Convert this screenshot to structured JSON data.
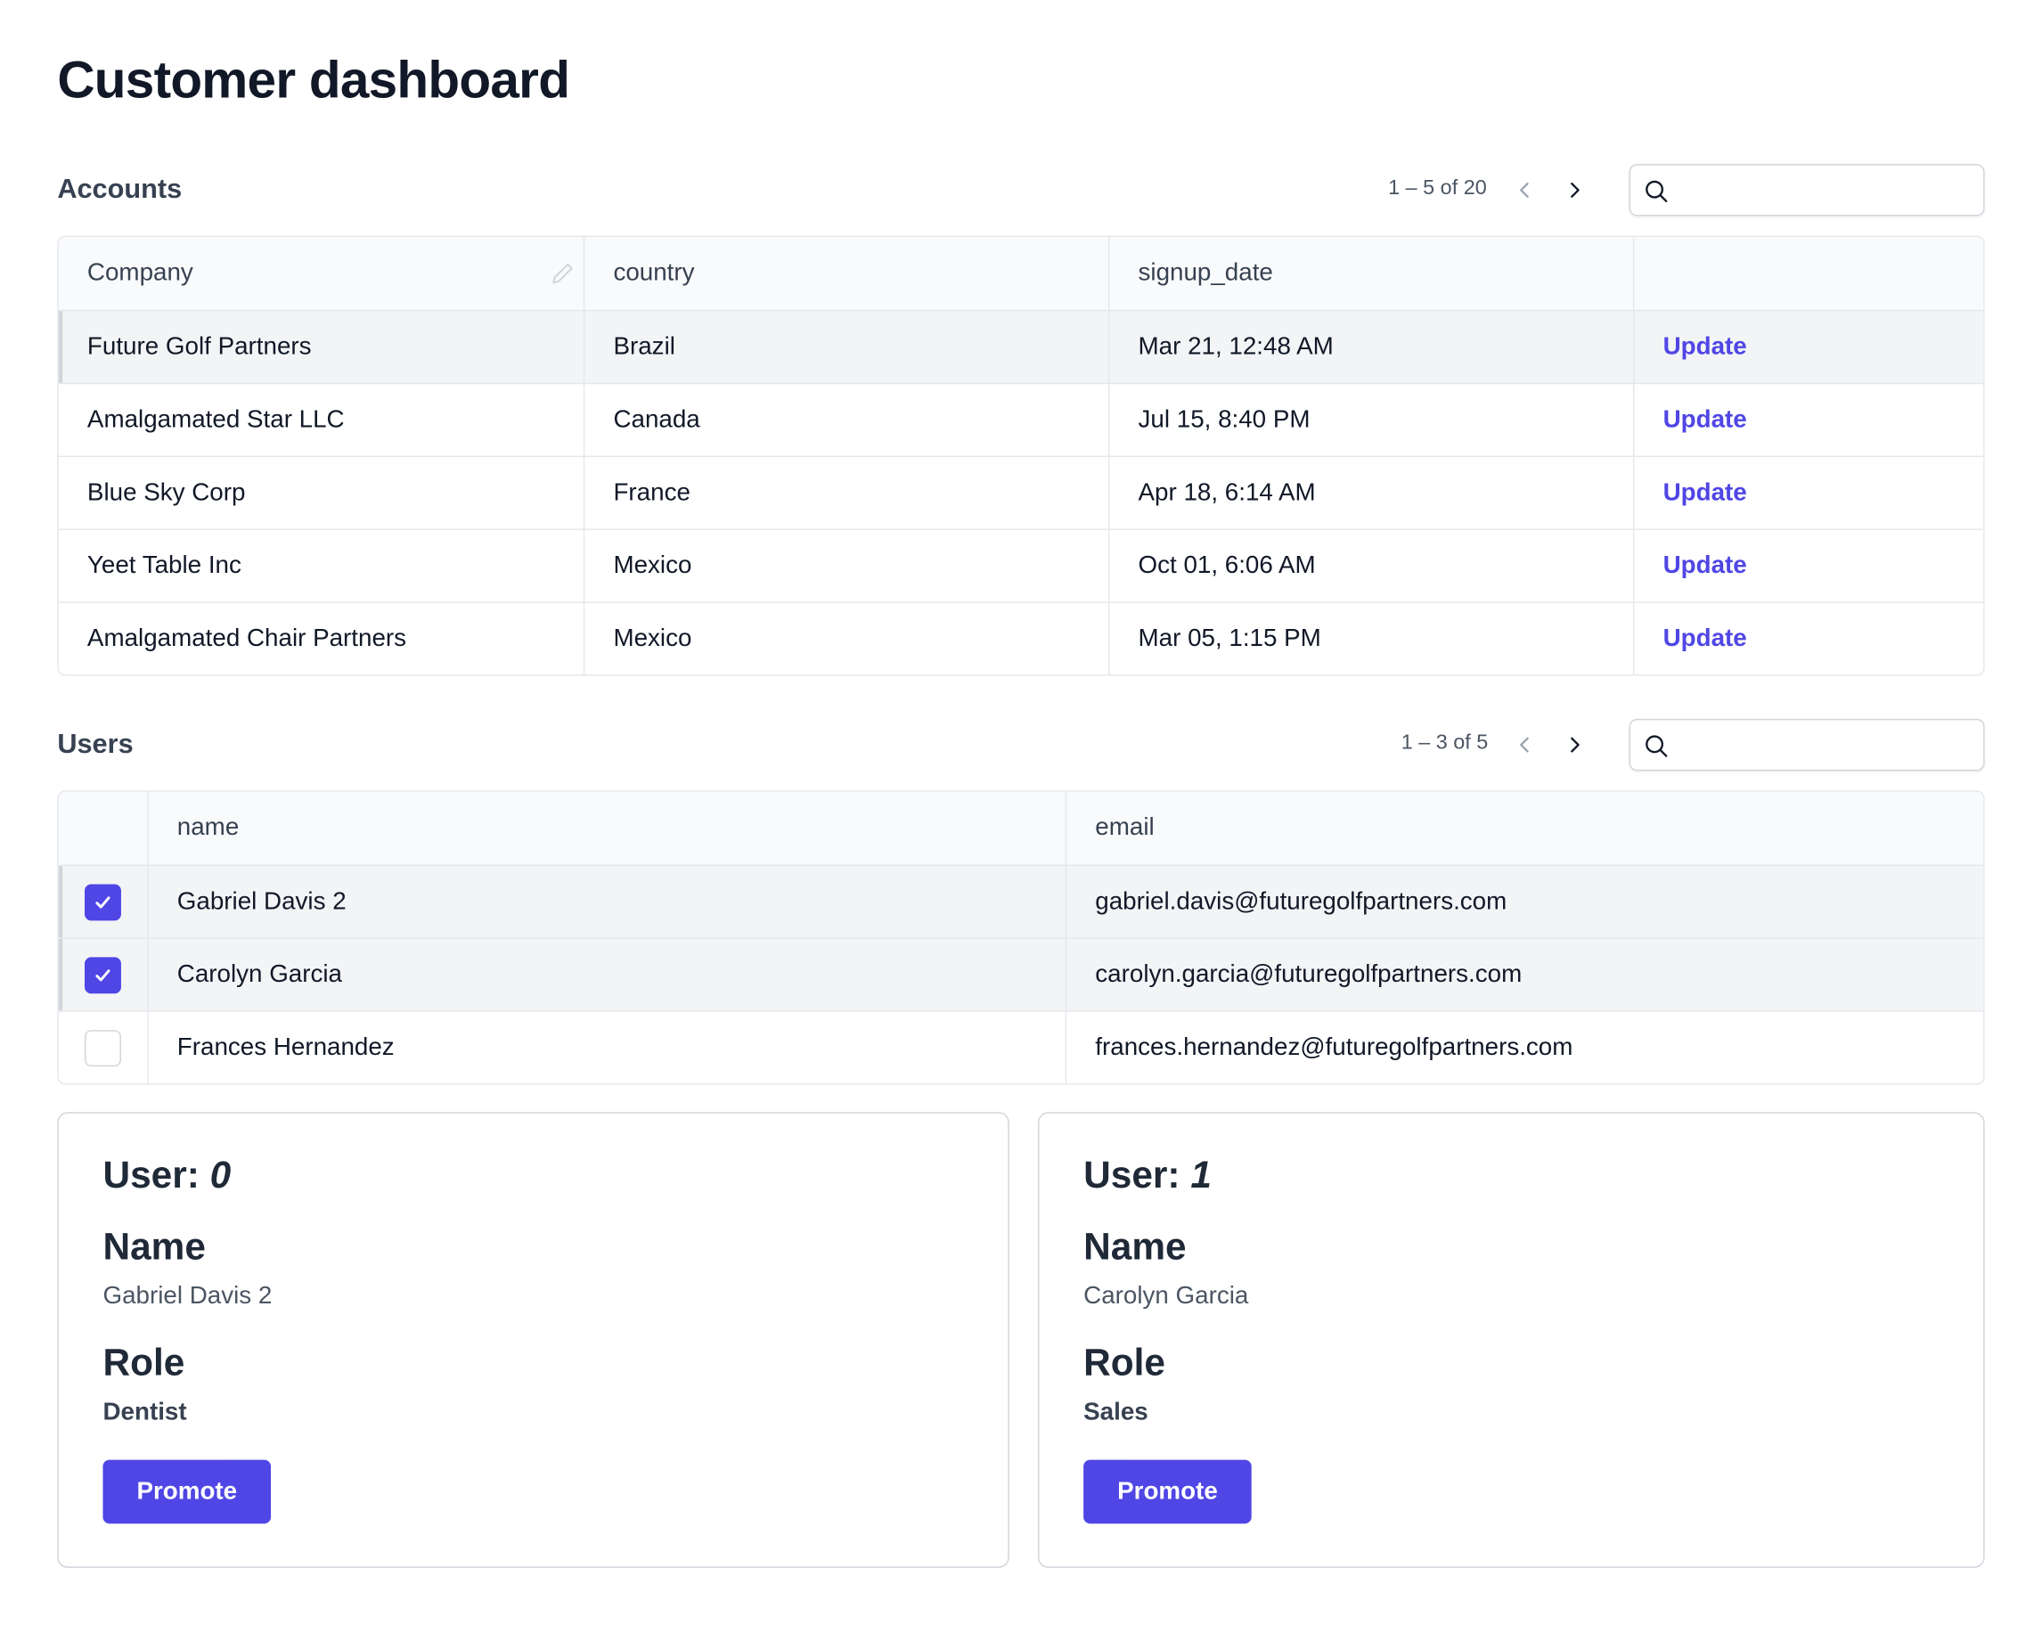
{
  "page": {
    "title": "Customer dashboard"
  },
  "accounts": {
    "title": "Accounts",
    "pagination": "1 – 5 of 20",
    "search": {
      "value": "",
      "placeholder": ""
    },
    "columns": [
      "Company",
      "country",
      "signup_date",
      ""
    ],
    "rows": [
      {
        "company": "Future Golf Partners",
        "country": "Brazil",
        "signup_date": "Mar 21, 12:48 AM",
        "action": "Update",
        "selected": true
      },
      {
        "company": "Amalgamated Star LLC",
        "country": "Canada",
        "signup_date": "Jul 15, 8:40 PM",
        "action": "Update",
        "selected": false
      },
      {
        "company": "Blue Sky Corp",
        "country": "France",
        "signup_date": "Apr 18, 6:14 AM",
        "action": "Update",
        "selected": false
      },
      {
        "company": "Yeet Table Inc",
        "country": "Mexico",
        "signup_date": "Oct 01, 6:06 AM",
        "action": "Update",
        "selected": false
      },
      {
        "company": "Amalgamated Chair Partners",
        "country": "Mexico",
        "signup_date": "Mar 05, 1:15 PM",
        "action": "Update",
        "selected": false
      }
    ]
  },
  "users": {
    "title": "Users",
    "pagination": "1 – 3 of 5",
    "search": {
      "value": "",
      "placeholder": ""
    },
    "columns": [
      "",
      "name",
      "email"
    ],
    "rows": [
      {
        "checked": true,
        "name": "Gabriel Davis 2",
        "email": "gabriel.davis@futuregolfpartners.com"
      },
      {
        "checked": true,
        "name": "Carolyn Garcia",
        "email": "carolyn.garcia@futuregolfpartners.com"
      },
      {
        "checked": false,
        "name": "Frances Hernandez",
        "email": "frances.hernandez@futuregolfpartners.com"
      }
    ]
  },
  "cards": [
    {
      "user_label": "User:",
      "user_index": "0",
      "name_label": "Name",
      "name": "Gabriel Davis 2",
      "role_label": "Role",
      "role": "Dentist",
      "button": "Promote"
    },
    {
      "user_label": "User:",
      "user_index": "1",
      "name_label": "Name",
      "name": "Carolyn Garcia",
      "role_label": "Role",
      "role": "Sales",
      "button": "Promote"
    }
  ],
  "icons": {
    "search": "search-icon",
    "prev": "chevron-left-icon",
    "next": "chevron-right-icon",
    "edit": "pencil-icon",
    "check": "check-icon"
  },
  "colors": {
    "accent": "#4f46e5",
    "selected_row": "#f3f4f6",
    "header_bg": "#f9fafb",
    "border": "#e5e7eb"
  }
}
